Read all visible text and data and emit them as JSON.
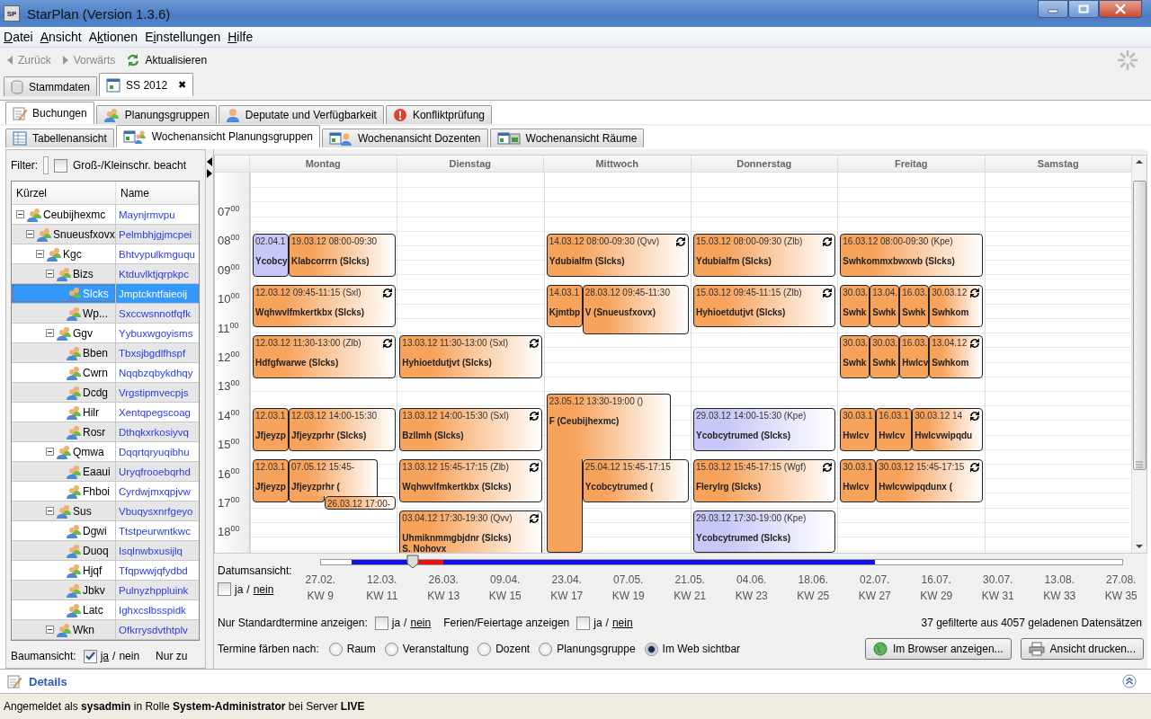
{
  "window": {
    "title": "StarPlan (Version 1.3.6)",
    "icon_text": "SP"
  },
  "menu": [
    {
      "key": "D",
      "post": "atei"
    },
    {
      "key": "A",
      "post": "nsicht"
    },
    {
      "pre": "A",
      "key": "k",
      "post": "tionen"
    },
    {
      "pre": "E",
      "key": "i",
      "post": "nstellungen"
    },
    {
      "key": "H",
      "post": "ilfe"
    }
  ],
  "toolbar": [
    {
      "label": "Zurück",
      "disabled": true
    },
    {
      "label": "Vorwärts",
      "disabled": true
    },
    {
      "label": "Aktualisieren",
      "disabled": false
    }
  ],
  "main_tabs": [
    {
      "label": "Stammdaten",
      "selected": false
    },
    {
      "label": "SS 2012",
      "selected": true,
      "close": "✖"
    }
  ],
  "section_tabs": [
    {
      "label": "Buchungen",
      "selected": true
    },
    {
      "label": "Planungsgruppen",
      "selected": false
    },
    {
      "label": "Deputate und Verfügbarkeit",
      "selected": false
    },
    {
      "label": "Konfliktprüfung",
      "selected": false
    }
  ],
  "view_tabs": [
    {
      "label": "Tabellenansicht",
      "selected": false
    },
    {
      "label": "Wochenansicht Planungsgruppen",
      "selected": true
    },
    {
      "label": "Wochenansicht Dozenten",
      "selected": false
    },
    {
      "label": "Wochenansicht Räume",
      "selected": false
    }
  ],
  "filter": {
    "label": "Filter:",
    "case_label": "Groß-/Kleinschr. beacht",
    "checked": false
  },
  "tree": {
    "columns": [
      "Kürzel",
      "Name"
    ],
    "items": [
      {
        "code": "Ceubijhexmc",
        "name": "Maynjrmvpu",
        "expanded": true,
        "selected": false,
        "children": [
          {
            "code": "Snueusfxovx",
            "name": "Pelmbhjgjmcpei",
            "expanded": true,
            "selected": false,
            "children": [
              {
                "code": "Kgc",
                "name": "Bhtvypulkmguqu",
                "expanded": true,
                "selected": false,
                "children": [
                  {
                    "code": "Bizs",
                    "name": "Ktduvlktjqrpkpc",
                    "expanded": true,
                    "selected": false,
                    "children": [
                      {
                        "code": "Slcks",
                        "name": "Jmptckntfaieoij",
                        "selected": true
                      },
                      {
                        "code": "Wp...",
                        "name": "Sxccwsnnotfqfk",
                        "selected": false
                      }
                    ]
                  },
                  {
                    "code": "Ggv",
                    "name": "Yybuxwgoyisms",
                    "expanded": true,
                    "selected": false,
                    "children": [
                      {
                        "code": "Bben",
                        "name": "Tbxsjbgdlfhspf",
                        "selected": false
                      },
                      {
                        "code": "Cwrn",
                        "name": "Nqqbzqbykdhqy",
                        "selected": false
                      },
                      {
                        "code": "Dcdg",
                        "name": "Vrgstipmvecpjs",
                        "selected": false
                      },
                      {
                        "code": "Hilr",
                        "name": "Xentqpegscoag",
                        "selected": false
                      },
                      {
                        "code": "Rosr",
                        "name": "Dthqkxrkosiyvq",
                        "selected": false
                      }
                    ]
                  },
                  {
                    "code": "Qmwa",
                    "name": "Dqqrtqryuqibhu",
                    "expanded": true,
                    "selected": false,
                    "children": [
                      {
                        "code": "Eaaui",
                        "name": "Uryqfrooebqrhd",
                        "selected": false
                      },
                      {
                        "code": "Fhboi",
                        "name": "Cyrdwjmxqpjvw",
                        "selected": false
                      }
                    ]
                  },
                  {
                    "code": "Sus",
                    "name": "Vbuqysxnrfgeyo",
                    "expanded": true,
                    "selected": false,
                    "children": [
                      {
                        "code": "Dgwi",
                        "name": "Ttstpeurwntkwc",
                        "selected": false
                      },
                      {
                        "code": "Duoq",
                        "name": "Isqlnwbxusijlq",
                        "selected": false
                      },
                      {
                        "code": "Hjqf",
                        "name": "Tfqpwwjqfydbd",
                        "selected": false
                      },
                      {
                        "code": "Jbkv",
                        "name": "Pulnyzhppluink",
                        "selected": false
                      },
                      {
                        "code": "Latc",
                        "name": "Ighxcslbsspidk",
                        "selected": false
                      }
                    ]
                  },
                  {
                    "code": "Wkn",
                    "name": "Ofkrrysdvthtplv",
                    "expanded": true,
                    "selected": false
                  }
                ]
              }
            ]
          }
        ]
      }
    ]
  },
  "tree_option": {
    "label": "Baumansicht:",
    "checked": true,
    "yes": "ja",
    "sep": "/",
    "no": "nein",
    "extra": "Nur zu"
  },
  "calendar": {
    "hours": [
      {
        "h": "07",
        "m": "00"
      },
      {
        "h": "08",
        "m": "00"
      },
      {
        "h": "09",
        "m": "00"
      },
      {
        "h": "10",
        "m": "00"
      },
      {
        "h": "11",
        "m": "00"
      },
      {
        "h": "12",
        "m": "00"
      },
      {
        "h": "13",
        "m": "00"
      },
      {
        "h": "14",
        "m": "00"
      },
      {
        "h": "15",
        "m": "00"
      },
      {
        "h": "16",
        "m": "00"
      },
      {
        "h": "17",
        "m": "00"
      },
      {
        "h": "18",
        "m": "00"
      }
    ],
    "days": [
      {
        "name": "Montag",
        "groups": [
          {
            "events": [
              {
                "date_line": "02.04.1",
                "title": "Ycobcy",
                "color": "#c8c8f8",
                "recurring": false
              },
              {
                "date_line": "19.03.12 08:00-09:30",
                "title": "Klabcorrrn (Slcks)",
                "color": "#f7a35c",
                "recurring": false
              }
            ]
          },
          {
            "events": [
              {
                "date_line": "12.03.12 09:45-11:15 (Sxl)",
                "title": "Wqhwvlfmkertkbx (Slcks)",
                "color": "#f7a35c",
                "recurring": true
              }
            ]
          },
          {
            "events": [
              {
                "date_line": "12.03.12 11:30-13:00 (Zlb)",
                "title": "Hdfgfwarwe (Slcks)",
                "color": "#f7a35c",
                "recurring": true
              }
            ]
          },
          {
            "events": [
              {
                "date_line": "12.03.1",
                "title": "Jfjeyzp",
                "color": "#f7a35c",
                "recurring": false
              },
              {
                "date_line": "12.03.12 14:00-15:30",
                "title": "Jfjeyzprhr (Slcks)",
                "color": "#f7a35c",
                "recurring": false
              }
            ]
          },
          {
            "events": [
              {
                "date_line": "12.03.1",
                "title": "Jfjeyzp",
                "color": "#f7a35c",
                "recurring": false
              },
              {
                "date_line": "07.05.12 15:45-",
                "title": "Jfjeyzprhr (",
                "color": "#f7a35c",
                "recurring": false
              },
              {
                "date_line": "26.03.12 17:00-",
                "color": "#f7a35c",
                "recurring": false
              }
            ]
          }
        ]
      },
      {
        "name": "Dienstag",
        "groups": [
          {
            "events": [
              {
                "date_line": "13.03.12 11:30-13:00 (Sxl)",
                "title": "Hyhioetdutjvt (Slcks)",
                "color": "#f7a35c",
                "recurring": true
              }
            ]
          },
          {
            "events": [
              {
                "date_line": "13.03.12 14:00-15:30 (Sxl)",
                "title": "Bzllmh (Slcks)",
                "color": "#f7a35c",
                "recurring": true
              }
            ]
          },
          {
            "events": [
              {
                "date_line": "13.03.12 15:45-17:15 (Zlb)",
                "title": "Wqhwvlfmkertkbx (Slcks)",
                "color": "#f7a35c",
                "recurring": true
              }
            ]
          },
          {
            "events": [
              {
                "date_line": "03.04.12 17:30-19:30 (Qvv)",
                "title": "Uhmiknmmgbjdnr (Slcks)",
                "note": "S. Nohovx",
                "color": "#f7a35c",
                "recurring": true
              }
            ]
          }
        ]
      },
      {
        "name": "Mittwoch",
        "groups": [
          {
            "events": [
              {
                "date_line": "14.03.12 08:00-09:30 (Qvv)",
                "title": "Ydubialfm (Slcks)",
                "color": "#f7a35c",
                "recurring": true
              }
            ]
          },
          {
            "events": [
              {
                "date_line": "14.03.1",
                "title": "Kjmtbp",
                "color": "#f7a35c",
                "recurring": false
              },
              {
                "date_line": "28.03.12 09:45-11:30",
                "title": "V (Snueusfxovx)",
                "color": "#f7a35c",
                "recurring": false
              }
            ]
          },
          {
            "events": [
              {
                "date_line": "23.05.12 13:30-19:00 ()",
                "title": "F (Ceubijhexmc)",
                "color": "#f7a35c",
                "recurring": false
              },
              {
                "date_line": "25.04.12 15:45-17:15",
                "title": "Ycobcytrumed (",
                "color": "#f7a35c",
                "recurring": false
              }
            ]
          }
        ]
      },
      {
        "name": "Donnerstag",
        "groups": [
          {
            "events": [
              {
                "date_line": "15.03.12 08:00-09:30 (Zlb)",
                "title": "Ydubialfm (Slcks)",
                "color": "#f7a35c",
                "recurring": true
              }
            ]
          },
          {
            "events": [
              {
                "date_line": "15.03.12 09:45-11:15 (Zlb)",
                "title": "Hyhioetdutjvt (Slcks)",
                "color": "#f7a35c",
                "recurring": true
              }
            ]
          },
          {
            "events": [
              {
                "date_line": "29.03.12 14:00-15:30 (Kpe)",
                "title": "Ycobcytrumed (Slcks)",
                "color": "#c8c8f8",
                "recurring": false
              }
            ]
          },
          {
            "events": [
              {
                "date_line": "15.03.12 15:45-17:15 (Wgf)",
                "title": "Flerylrg (Slcks)",
                "color": "#f7a35c",
                "recurring": true
              }
            ]
          },
          {
            "events": [
              {
                "date_line": "29.03.12 17:30-19:00 (Kpe)",
                "title": "Ycobcytrumed (Slcks)",
                "color": "#c8c8f8",
                "recurring": false
              }
            ]
          }
        ]
      },
      {
        "name": "Freitag",
        "groups": [
          {
            "events": [
              {
                "date_line": "16.03.12 08:00-09:30 (Kpe)",
                "title": "Swhkommxbwxwb (Slcks)",
                "color": "#f7a35c",
                "recurring": false
              }
            ]
          },
          {
            "events": [
              {
                "date_line": "30.03.",
                "title": "Swhk",
                "color": "#f7a35c",
                "recurring": false
              },
              {
                "date_line": "13.04.",
                "title": "Swhk",
                "color": "#f7a35c",
                "recurring": false
              },
              {
                "date_line": "16.03.",
                "title": "Swhk",
                "color": "#f7a35c",
                "recurring": false
              },
              {
                "date_line": "30.03.12",
                "title": "Swhkom",
                "color": "#f7a35c",
                "recurring": true
              }
            ]
          },
          {
            "events": [
              {
                "date_line": "30.03.",
                "title": "Swhk",
                "color": "#f7a35c",
                "recurring": false
              },
              {
                "date_line": "30.03.",
                "title": "Swhk",
                "color": "#f7a35c",
                "recurring": false
              },
              {
                "date_line": "16.03.",
                "title": "Hwlcv",
                "color": "#f7a35c",
                "recurring": false
              },
              {
                "date_line": "13.04.12",
                "title": "Swhkom",
                "color": "#f7a35c",
                "recurring": true
              }
            ]
          },
          {
            "events": [
              {
                "date_line": "30.03.1",
                "title": "Hwlcv",
                "color": "#f7a35c",
                "recurring": false
              },
              {
                "date_line": "16.03.1",
                "title": "Hwlcv",
                "color": "#f7a35c",
                "recurring": false
              },
              {
                "date_line": "30.03.12 14",
                "title": "Hwlcvwipqdu",
                "color": "#f7a35c",
                "recurring": true
              }
            ]
          },
          {
            "events": [
              {
                "date_line": "30.03.1",
                "title": "Hwlcv",
                "color": "#f7a35c",
                "recurring": false
              },
              {
                "date_line": "30.03.12 15:45-17:15",
                "title": "Hwlcvwipqdunx (",
                "color": "#f7a35c",
                "recurring": true
              }
            ]
          }
        ]
      },
      {
        "name": "Samstag"
      }
    ]
  },
  "timeline": {
    "label": "Datumsansicht:",
    "checked": false,
    "yes": "ja",
    "sep": "/",
    "no": "nein",
    "ticks": [
      {
        "date": "27.02.",
        "week": "KW 9",
        "in_range": false,
        "selected": false
      },
      {
        "date": "12.03.",
        "week": "KW 11",
        "in_range": true,
        "selected": false
      },
      {
        "date": "26.03.",
        "week": "KW 13",
        "in_range": true,
        "selected": true
      },
      {
        "date": "09.04.",
        "week": "KW 15",
        "in_range": true,
        "selected": false
      },
      {
        "date": "23.04.",
        "week": "KW 17",
        "in_range": true,
        "selected": false
      },
      {
        "date": "07.05.",
        "week": "KW 19",
        "in_range": true,
        "selected": false
      },
      {
        "date": "21.05.",
        "week": "KW 21",
        "in_range": true,
        "selected": false
      },
      {
        "date": "04.06.",
        "week": "KW 23",
        "in_range": true,
        "selected": false
      },
      {
        "date": "18.06.",
        "week": "KW 25",
        "in_range": true,
        "selected": false
      },
      {
        "date": "02.07.",
        "week": "KW 27",
        "in_range": true,
        "selected": false
      },
      {
        "date": "16.07.",
        "week": "KW 29",
        "in_range": false,
        "selected": false
      },
      {
        "date": "30.07.",
        "week": "KW 31",
        "in_range": false,
        "selected": false
      },
      {
        "date": "13.08.",
        "week": "KW 33",
        "in_range": false,
        "selected": false
      },
      {
        "date": "27.08.",
        "week": "KW 35",
        "in_range": false,
        "selected": false
      }
    ]
  },
  "options": [
    {
      "label": "Nur Standardtermine anzeigen:",
      "checked": false,
      "yes": "ja",
      "sep": "/",
      "no": "nein"
    },
    {
      "label": "Ferien/Feiertage anzeigen",
      "checked": false,
      "yes": "ja",
      "sep": "/",
      "no": "nein"
    }
  ],
  "count": "37 gefilterte aus 4057 geladenen Datensätzen",
  "color_by": {
    "label": "Termine färben nach:",
    "options": [
      {
        "label": "Raum",
        "selected": false
      },
      {
        "label": "Veranstaltung",
        "selected": false
      },
      {
        "label": "Dozent",
        "selected": false
      },
      {
        "label": "Planungsgruppe",
        "selected": false
      },
      {
        "label": "Im Web sichtbar",
        "selected": true
      }
    ]
  },
  "buttons": [
    {
      "label": "Im Browser anzeigen..."
    },
    {
      "label": "Ansicht drucken..."
    }
  ],
  "details": {
    "label": "Details"
  },
  "status": "Angemeldet als **sysadmin** in Rolle **System-Administrator** bei Server **LIVE**"
}
